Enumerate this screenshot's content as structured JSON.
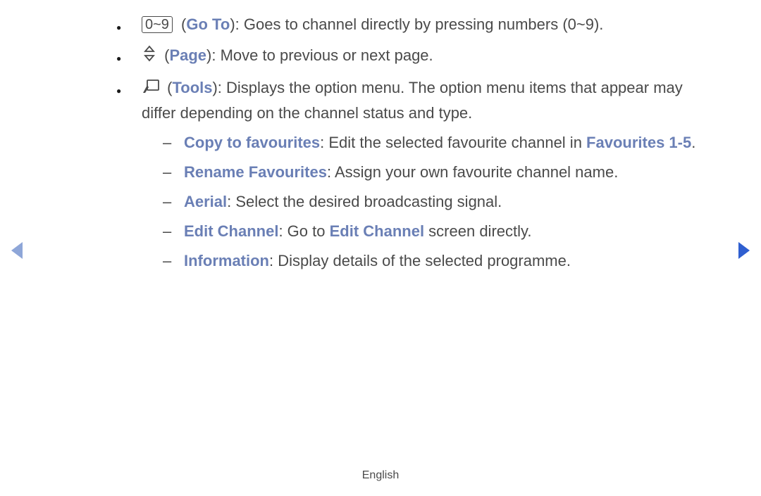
{
  "bullets": {
    "goto": {
      "numbox": "0~9",
      "label": "Go To",
      "desc": "): Goes to channel directly by pressing numbers (0~9)."
    },
    "page": {
      "label": "Page",
      "desc": "): Move to previous or next page."
    },
    "tools": {
      "label": "Tools",
      "desc_a": "): Displays the option menu. The option menu items that appear may differ depending on the channel status and type."
    }
  },
  "sub": {
    "copy": {
      "label": "Copy to favourites",
      "desc_a": ": Edit the selected favourite channel in ",
      "fav_label": "Favourites 1-5",
      "desc_b": "."
    },
    "rename": {
      "label": "Rename Favourites",
      "desc": ": Assign your own favourite channel name."
    },
    "aerial": {
      "label": "Aerial",
      "desc": ": Select the desired broadcasting signal."
    },
    "edit": {
      "label": "Edit Channel",
      "desc_a": ": Go to ",
      "link": "Edit Channel",
      "desc_b": " screen directly."
    },
    "info": {
      "label": "Information",
      "desc": ": Display details of the selected programme."
    }
  },
  "footer": {
    "language": "English"
  },
  "paren_open": " ("
}
